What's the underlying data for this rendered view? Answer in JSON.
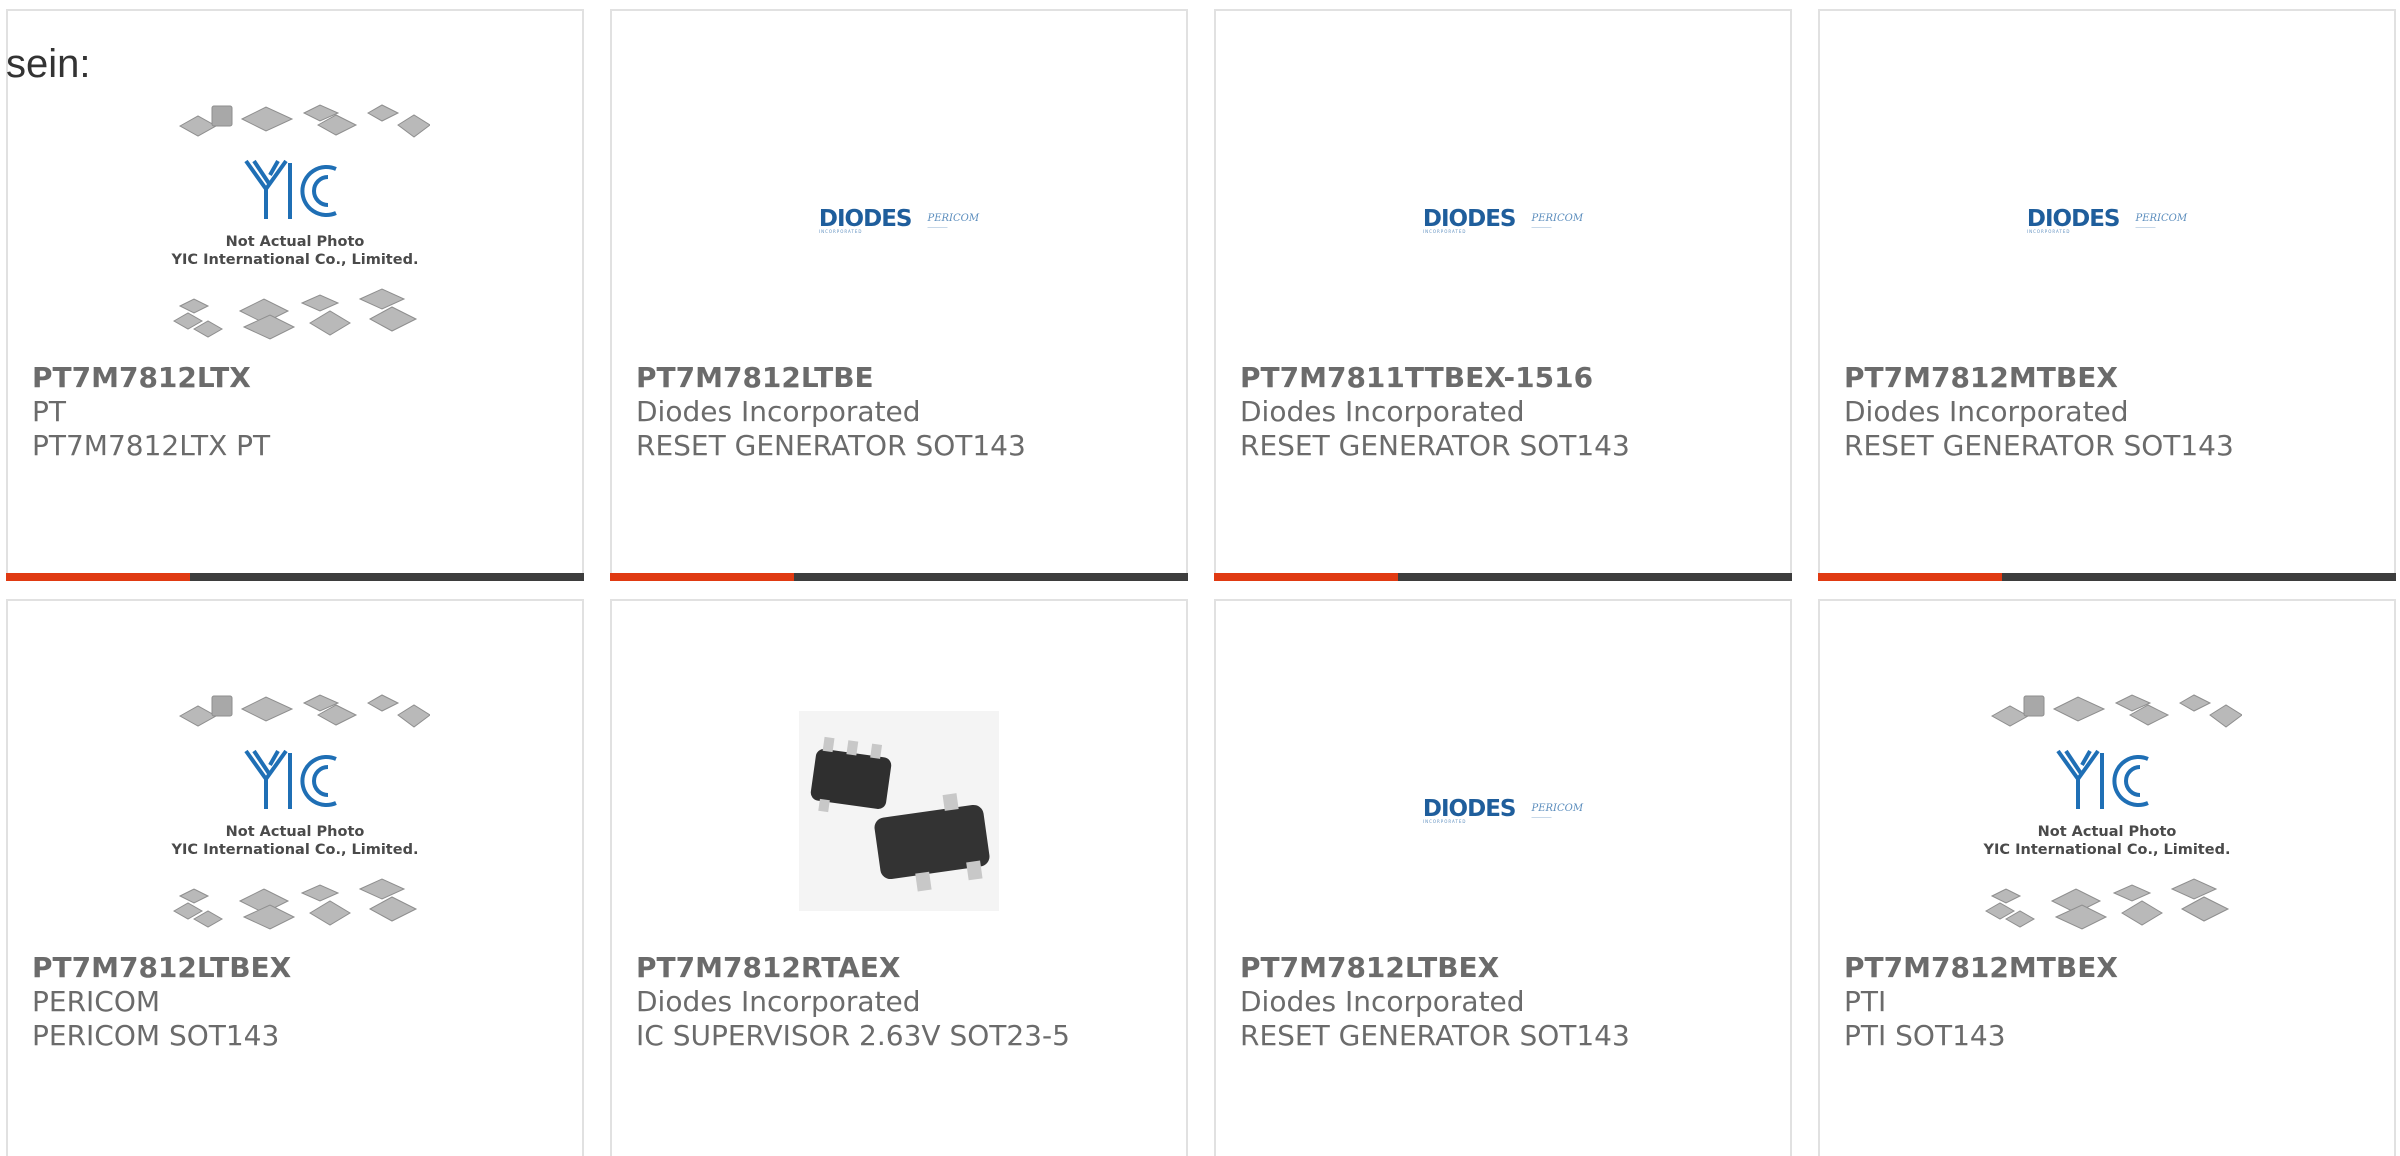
{
  "intro_text": "sein:",
  "placeholder": {
    "logo_text": "YIC",
    "line1": "Not Actual Photo",
    "line2": "YIC International Co., Limited."
  },
  "diodes_logo": {
    "brand": "DIODES",
    "brand_sub": "INCORPORATED",
    "partner": "PERICOM"
  },
  "accent_color": "#e03a12",
  "bar_color": "#3d3d3d",
  "products": [
    {
      "part_number": "PT7M7812LTX",
      "manufacturer": "PT",
      "description": "PT7M7812LTX PT",
      "image": "not-actual-photo"
    },
    {
      "part_number": "PT7M7812LTBE",
      "manufacturer": "Diodes Incorporated",
      "description": "RESET GENERATOR SOT143",
      "image": "diodes-logo"
    },
    {
      "part_number": "PT7M7811TTBEX-1516",
      "manufacturer": "Diodes Incorporated",
      "description": "RESET GENERATOR SOT143",
      "image": "diodes-logo"
    },
    {
      "part_number": "PT7M7812MTBEX",
      "manufacturer": "Diodes Incorporated",
      "description": "RESET GENERATOR SOT143",
      "image": "diodes-logo"
    },
    {
      "part_number": "PT7M7812LTBEX",
      "manufacturer": "PERICOM",
      "description": "PERICOM SOT143",
      "image": "not-actual-photo"
    },
    {
      "part_number": "PT7M7812RTAEX",
      "manufacturer": "Diodes Incorporated",
      "description": "IC SUPERVISOR 2.63V SOT23-5",
      "image": "sot23-photo"
    },
    {
      "part_number": "PT7M7812LTBEX",
      "manufacturer": "Diodes Incorporated",
      "description": "RESET GENERATOR SOT143",
      "image": "diodes-logo"
    },
    {
      "part_number": "PT7M7812MTBEX",
      "manufacturer": "PTI",
      "description": "PTI SOT143",
      "image": "not-actual-photo"
    }
  ]
}
